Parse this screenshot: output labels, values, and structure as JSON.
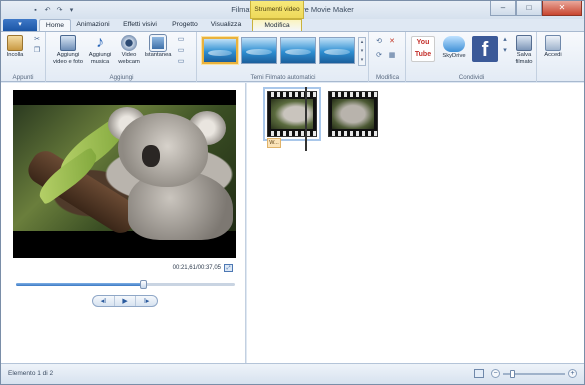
{
  "window": {
    "title": "Filmato - Windows Live Movie Maker",
    "context_tab_title": "Strumenti video"
  },
  "qat": [
    "save-icon",
    "undo-icon",
    "redo-icon",
    "dropdown-icon"
  ],
  "window_buttons": {
    "minimize": "–",
    "maximize": "□",
    "close": "✕"
  },
  "tabs": {
    "app_menu": "▾",
    "items": [
      "Home",
      "Animazioni",
      "Effetti visivi",
      "Progetto",
      "Visualizza",
      "Modifica"
    ],
    "active": "Home"
  },
  "ribbon": {
    "groups": {
      "appunti": {
        "label": "Appunti",
        "paste": "Incolla"
      },
      "aggiungi": {
        "label": "Aggiungi",
        "add_video": "Aggiungi video e foto",
        "add_music": "Aggiungi musica",
        "webcam": "Video webcam",
        "snapshot": "Istantanea"
      },
      "temi": {
        "label": "Temi Filmato automatici"
      },
      "modifica": {
        "label": "Modifica"
      },
      "condividi": {
        "label": "Condividi",
        "youtube": "You Tube",
        "skydrive": "SkyDrive",
        "facebook": "f",
        "save_movie": "Salva filmato"
      },
      "accedi": {
        "label": "Accedi"
      }
    }
  },
  "preview": {
    "timecode": "00:21,61/00:37,05",
    "progress": 0.58
  },
  "playback": {
    "prev": "◂I",
    "play": "▶",
    "next": "I▸"
  },
  "storyboard": {
    "clip_caption": "W...",
    "clips": [
      {
        "name": "clip-1"
      },
      {
        "name": "clip-2"
      }
    ]
  },
  "status": {
    "text": "Elemento 1 di 2",
    "zoom_out": "−",
    "zoom_in": "+",
    "zoom_level": 0.15
  }
}
